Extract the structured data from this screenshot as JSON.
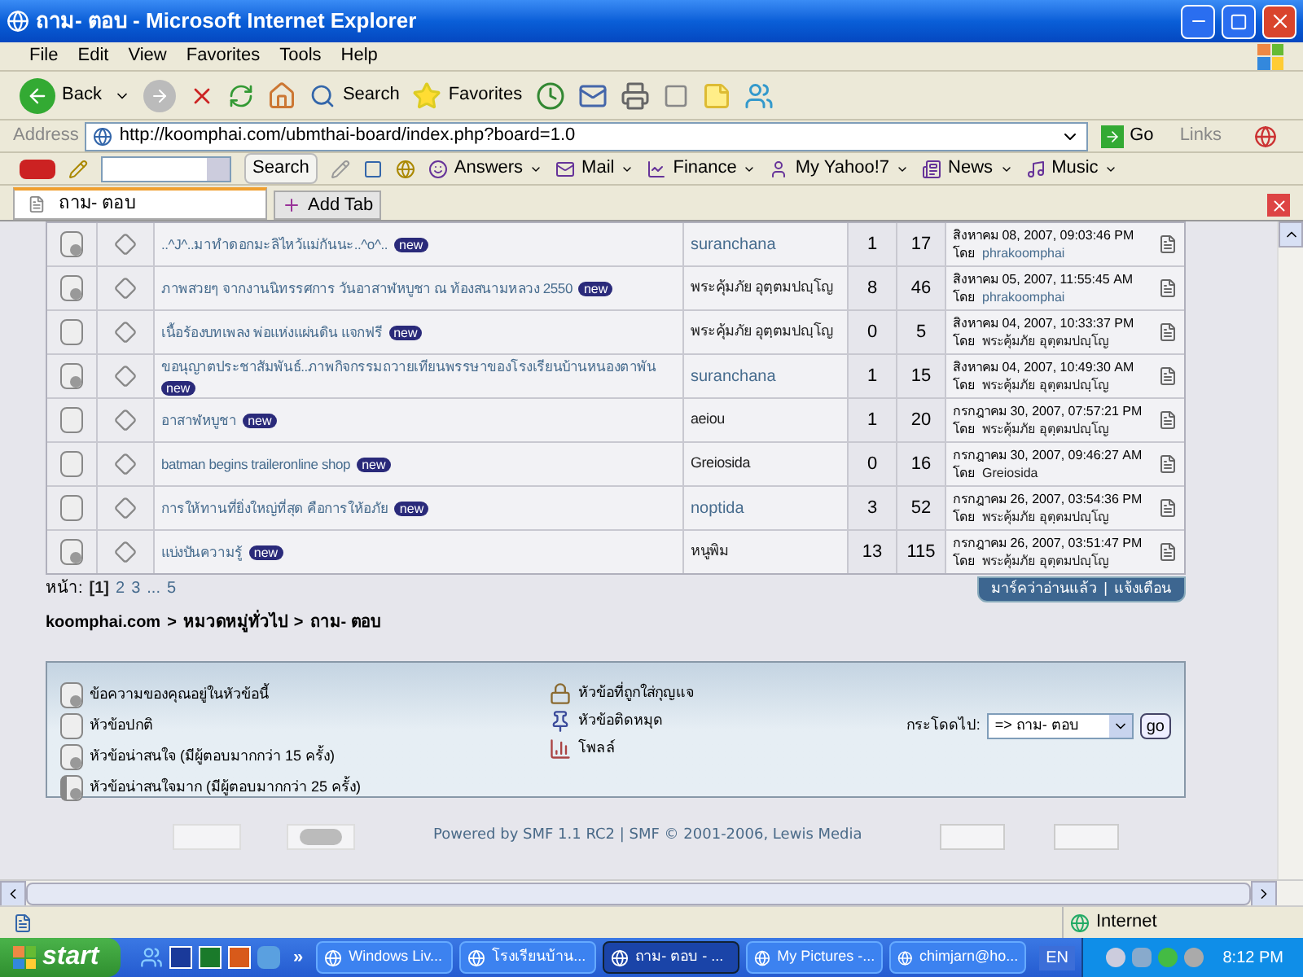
{
  "window": {
    "title": "ถาม- ตอบ - Microsoft Internet Explorer"
  },
  "menu": [
    "File",
    "Edit",
    "View",
    "Favorites",
    "Tools",
    "Help"
  ],
  "toolbar": {
    "back": "Back",
    "search": "Search",
    "favorites": "Favorites"
  },
  "address": {
    "label": "Address",
    "url": "http://koomphai.com/ubmthai-board/index.php?board=1.0",
    "go": "Go",
    "links": "Links"
  },
  "yahoo_bar": {
    "search": "Search",
    "items": [
      "Answers",
      "Mail",
      "Finance",
      "My Yahoo!7",
      "News",
      "Music"
    ]
  },
  "tabs": [
    {
      "label": "ถาม- ตอบ",
      "selected": true
    }
  ],
  "add_tab": "Add Tab",
  "topics": {
    "rows": [
      {
        "kind": "hot",
        "subject": "..^J^..มาทำดอกมะลิไหว้แม่กันนะ..^o^..",
        "badge": "new",
        "starter": "suranchana",
        "starter_link": true,
        "replies": "1",
        "views": "17",
        "last_date": "สิงหาคม 08, 2007, 09:03:46 PM",
        "by_prefix": "โดย",
        "last_by": "phrakoomphai",
        "last_by_link": true
      },
      {
        "kind": "hot",
        "subject": "ภาพสวยๆ จากงานนิทรรศการ วันอาสาฬหบูชา ณ ท้องสนามหลวง 2550",
        "badge": "new",
        "starter": "พระคุ้มภัย อุตฺตมปญฺโญ",
        "starter_link": false,
        "replies": "8",
        "views": "46",
        "last_date": "สิงหาคม 05, 2007, 11:55:45 AM",
        "by_prefix": "โดย",
        "last_by": "phrakoomphai",
        "last_by_link": true
      },
      {
        "kind": "normal",
        "subject": "เนื้อร้องบทเพลง พ่อแห่งแผ่นดิน แจกฟรี",
        "badge": "new",
        "starter": "พระคุ้มภัย อุตฺตมปญฺโญ",
        "starter_link": false,
        "replies": "0",
        "views": "5",
        "last_date": "สิงหาคม 04, 2007, 10:33:37 PM",
        "by_prefix": "โดย",
        "last_by": "พระคุ้มภัย อุตฺตมปญฺโญ",
        "last_by_link": false
      },
      {
        "kind": "hot",
        "subject": "ขอนุญาตประชาสัมพันธ์..ภาพกิจกรรมถวายเทียนพรรษาของโรงเรียนบ้านหนองตาพัน",
        "badge": "new",
        "starter": "suranchana",
        "starter_link": true,
        "replies": "1",
        "views": "15",
        "last_date": "สิงหาคม 04, 2007, 10:49:30 AM",
        "by_prefix": "โดย",
        "last_by": "พระคุ้มภัย อุตฺตมปญฺโญ",
        "last_by_link": false
      },
      {
        "kind": "normal",
        "subject": "อาสาฬหบูชา",
        "badge": "new",
        "starter": "aeiou",
        "starter_link": false,
        "replies": "1",
        "views": "20",
        "last_date": "กรกฎาคม 30, 2007, 07:57:21 PM",
        "by_prefix": "โดย",
        "last_by": "พระคุ้มภัย อุตฺตมปญฺโญ",
        "last_by_link": false
      },
      {
        "kind": "normal",
        "subject": "batman begins traileronline shop",
        "badge": "new",
        "starter": "Greiosida",
        "starter_link": false,
        "replies": "0",
        "views": "16",
        "last_date": "กรกฎาคม 30, 2007, 09:46:27 AM",
        "by_prefix": "โดย",
        "last_by": "Greiosida",
        "last_by_link": false
      },
      {
        "kind": "normal",
        "subject": "การให้ทานที่ยิ่งใหญ่ที่สุด คือการให้อภัย",
        "badge": "new",
        "starter": "noptida",
        "starter_link": true,
        "replies": "3",
        "views": "52",
        "last_date": "กรกฎาคม 26, 2007, 03:54:36 PM",
        "by_prefix": "โดย",
        "last_by": "พระคุ้มภัย อุตฺตมปญฺโญ",
        "last_by_link": false
      },
      {
        "kind": "hot",
        "subject": "แบ่งปันความรู้",
        "badge": "new",
        "starter": "หนูพิม",
        "starter_link": false,
        "replies": "13",
        "views": "115",
        "last_date": "กรกฎาคม 26, 2007, 03:51:47 PM",
        "by_prefix": "โดย",
        "last_by": "พระคุ้มภัย อุตฺตมปญฺโญ",
        "last_by_link": false
      }
    ]
  },
  "pagination": {
    "label": "หน้า:",
    "pages": [
      {
        "label": "[1]",
        "selected": true
      },
      {
        "label": "2",
        "selected": false
      },
      {
        "label": "3",
        "selected": false
      },
      {
        "label": "...",
        "selected": false
      },
      {
        "label": "5",
        "selected": false
      }
    ]
  },
  "actions": [
    "มาร์คว่าอ่านแล้ว",
    "แจ้งเตือน"
  ],
  "action_separator": "|",
  "breadcrumb": {
    "separator": ">",
    "items": [
      "koomphai.com",
      "หมวดหมู่ทั่วไป",
      "ถาม- ตอบ"
    ]
  },
  "legend": {
    "left": [
      {
        "kind": "my",
        "label": "ข้อความของคุณอยู่ในหัวข้อนี้"
      },
      {
        "kind": "normal",
        "label": "หัวข้อปกติ"
      },
      {
        "kind": "hot",
        "label": "หัวข้อน่าสนใจ (มีผู้ตอบมากกว่า 15 ครั้ง)"
      },
      {
        "kind": "veryhot",
        "label": "หัวข้อน่าสนใจมาก (มีผู้ตอบมากกว่า 25 ครั้ง)"
      }
    ],
    "middle": [
      {
        "kind": "locked",
        "label": "หัวข้อที่ถูกใส่กุญแจ"
      },
      {
        "kind": "sticky",
        "label": "หัวข้อติดหมุด"
      },
      {
        "kind": "poll",
        "label": "โพลล์"
      }
    ]
  },
  "jump": {
    "label": "กระโดดไป:",
    "value": "=> ถาม- ตอบ",
    "button": "go"
  },
  "footer": {
    "powered": "Powered by SMF 1.1 RC2 | SMF © 2001-2006, Lewis Media"
  },
  "status": {
    "zone": "Internet"
  },
  "taskbar": {
    "start": "start",
    "more": "»",
    "tasks": [
      {
        "label": "Windows Liv...",
        "selected": false
      },
      {
        "label": "โรงเรียนบ้าน...",
        "selected": false
      },
      {
        "label": "ถาม- ตอบ - ...",
        "selected": true
      },
      {
        "label": "My Pictures -...",
        "selected": false
      },
      {
        "label": "chimjarn@ho...",
        "selected": false
      }
    ],
    "language": "EN",
    "clock": "8:12 PM"
  }
}
